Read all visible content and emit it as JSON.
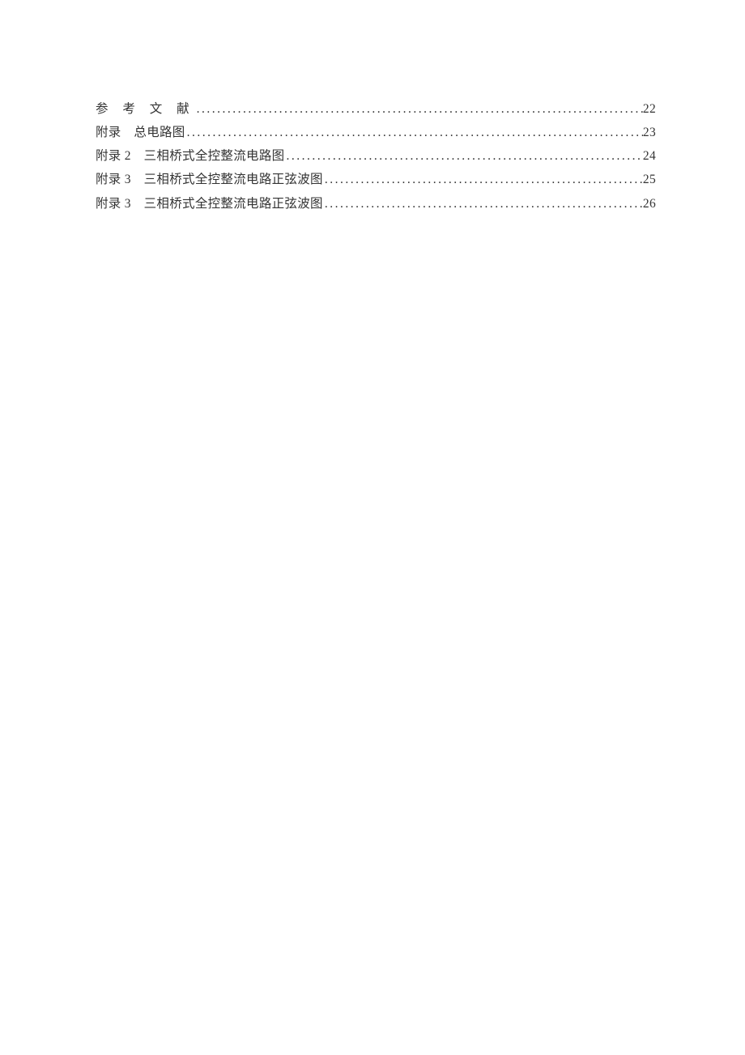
{
  "toc": {
    "entries": [
      {
        "title": "参 考 文 献",
        "page": "22",
        "spaced": true
      },
      {
        "title": "附录　总电路图",
        "page": "23",
        "spaced": false
      },
      {
        "title": "附录 2　三相桥式全控整流电路图",
        "page": "24",
        "spaced": false
      },
      {
        "title": "附录 3　三相桥式全控整流电路正弦波图",
        "page": "25",
        "spaced": false
      },
      {
        "title": "附录 3　三相桥式全控整流电路正弦波图",
        "page": "26",
        "spaced": false
      }
    ]
  }
}
